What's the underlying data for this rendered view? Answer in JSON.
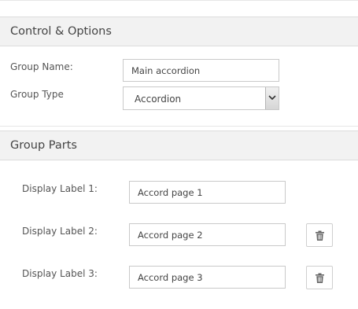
{
  "control_section": {
    "title": "Control & Options",
    "group_name_label": "Group Name:",
    "group_name_value": "Main accordion",
    "group_type_label": "Group Type",
    "group_type_value": "Accordion"
  },
  "parts_section": {
    "title": "Group Parts",
    "parts": [
      {
        "label": "Display Label 1:",
        "value": "Accord page 1",
        "deletable": false
      },
      {
        "label": "Display Label 2:",
        "value": "Accord page 2",
        "deletable": true,
        "delete_icon": "trash-icon"
      },
      {
        "label": "Display Label 3:",
        "value": "Accord page 3",
        "deletable": true,
        "delete_icon": "trash-icon"
      }
    ]
  }
}
